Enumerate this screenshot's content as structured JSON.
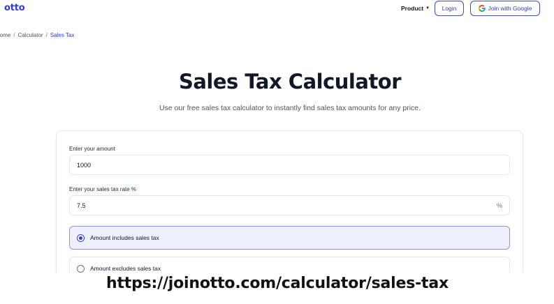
{
  "header": {
    "logo": "otto",
    "nav_product": "Product",
    "login_label": "Login",
    "google_label": "Join with Google"
  },
  "breadcrumb": {
    "items": [
      "Home",
      "Calculator",
      "Sales Tax"
    ],
    "separator": "/"
  },
  "main": {
    "title": "Sales Tax Calculator",
    "subtitle": "Use our free sales tax calculator to instantly find sales tax amounts for any price."
  },
  "form": {
    "amount_label": "Enter your amount",
    "amount_value": "1000",
    "rate_label": "Enter your sales tax rate %",
    "rate_value": "7.5",
    "rate_suffix": "%",
    "options": [
      {
        "label": "Amount includes sales tax",
        "selected": true
      },
      {
        "label": "Amount excludes sales tax",
        "selected": false
      }
    ]
  },
  "banner": {
    "url": "https://joinotto.com/calculator/sales-tax"
  },
  "colors": {
    "brand": "#2f3bd9",
    "selected_bg": "#eef0fd"
  }
}
